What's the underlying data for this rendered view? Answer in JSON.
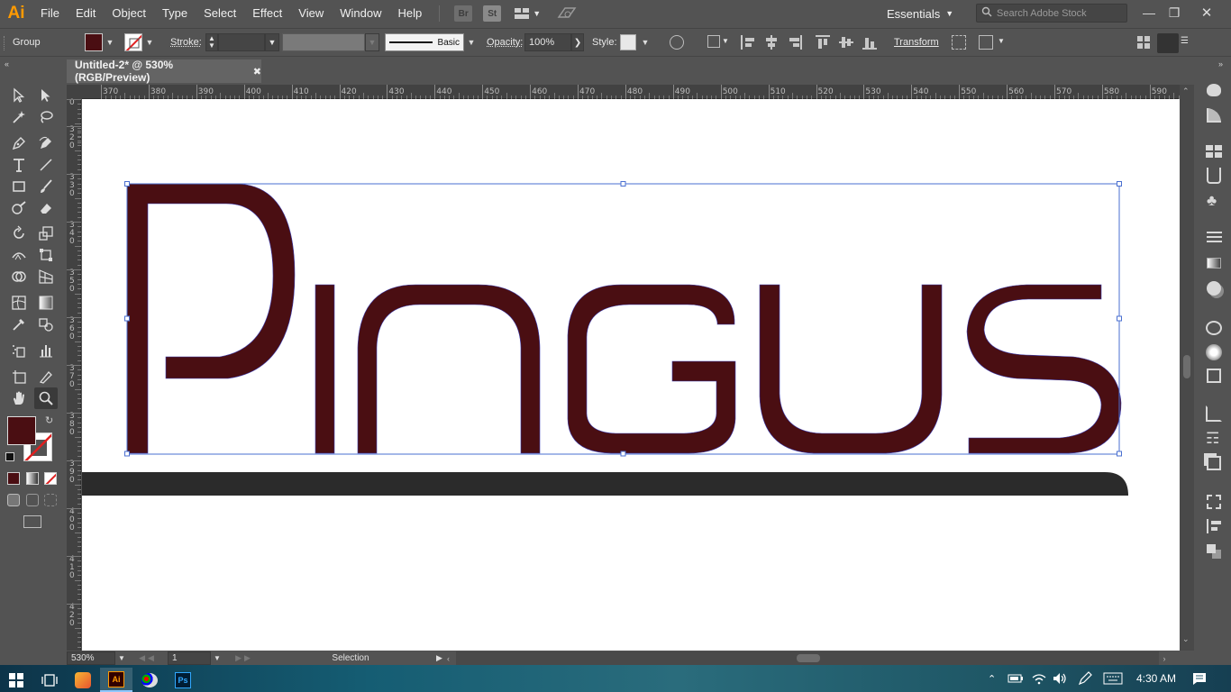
{
  "app": {
    "logo": "Ai",
    "menus": [
      "File",
      "Edit",
      "Object",
      "Type",
      "Select",
      "Effect",
      "View",
      "Window",
      "Help"
    ],
    "bridge_label": "Br",
    "stock_label": "St",
    "workspace": "Essentials",
    "search_placeholder": "Search Adobe Stock"
  },
  "control_bar": {
    "selection_type": "Group",
    "fill_color": "#4a0e12",
    "stroke_label": "Stroke:",
    "stroke_style": "Basic",
    "opacity_label": "Opacity:",
    "opacity_value": "100%",
    "style_label": "Style:",
    "transform_label": "Transform"
  },
  "document": {
    "tab_title": "Untitled-2* @ 530% (RGB/Preview)",
    "artwork_text": "PINGUS",
    "artwork_color": "#4a0e12",
    "zoom": "530%",
    "artboard_number": "1",
    "status_text": "Selection"
  },
  "rulers": {
    "horizontal": [
      "370",
      "380",
      "390",
      "400",
      "410",
      "420",
      "430",
      "440",
      "450",
      "460",
      "470",
      "480",
      "490",
      "500",
      "510",
      "520",
      "530",
      "540",
      "550",
      "560",
      "570",
      "580",
      "590"
    ],
    "vertical": [
      "0",
      "3\n2\n0",
      "3\n3\n0",
      "3\n4\n0",
      "3\n5\n0",
      "3\n6\n0",
      "3\n7\n0",
      "3\n8\n0",
      "3\n9\n0",
      "4\n0\n0",
      "4\n1\n0",
      "4\n2\n0"
    ]
  },
  "taskbar": {
    "time": "4:30 AM"
  }
}
